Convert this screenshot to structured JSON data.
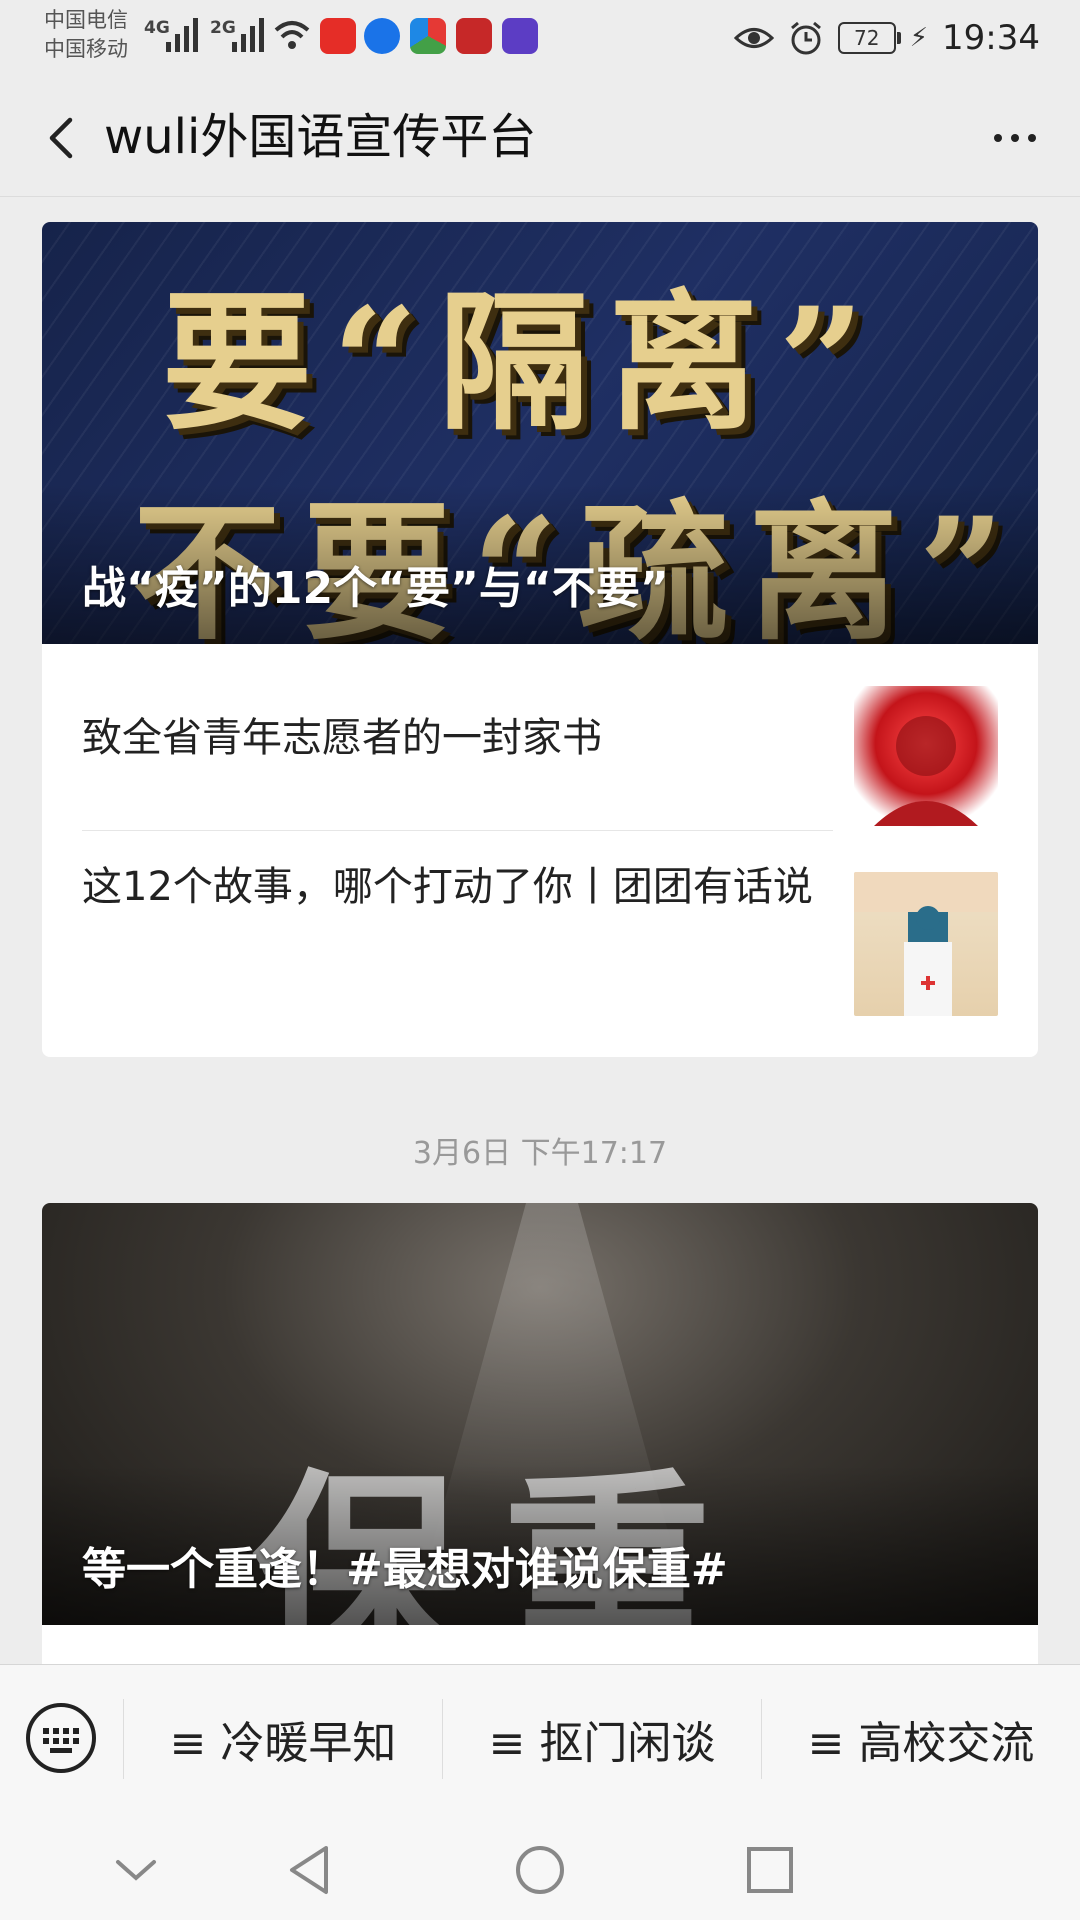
{
  "status_bar": {
    "carrier1": "中国电信",
    "carrier2": "中国移动",
    "net1": "4G",
    "net2": "2G",
    "battery": "72",
    "time": "19:34",
    "icons": [
      "wifi-icon",
      "sohu-video-icon",
      "browser-icon",
      "news-icon",
      "study-app-icon",
      "music-app-icon",
      "eye-icon",
      "alarm-icon",
      "charging-icon"
    ]
  },
  "header": {
    "title": "wuli外国语宣传平台"
  },
  "feed": {
    "article1": {
      "cover_line1": "要“隔离”",
      "cover_line2": "不要“疏离”",
      "title": "战“疫”的12个“要”与“不要”"
    },
    "article2": {
      "title": "致全省青年志愿者的一封家书"
    },
    "article3": {
      "title": "这12个故事，哪个打动了你丨团团有话说"
    },
    "date": "3月6日 下午17:17",
    "article4": {
      "cover_text": "保重",
      "title": "等一个重逢！#最想对谁说保重#"
    }
  },
  "menu": {
    "items": [
      "≡ 冷暖早知",
      "≡ 抠门闲谈",
      "≡ 高校交流"
    ]
  },
  "colors": {
    "background": "#ededed",
    "card": "#ffffff",
    "cover_gold": "#e6cf8e",
    "cover_blue": "#1f2f63"
  }
}
